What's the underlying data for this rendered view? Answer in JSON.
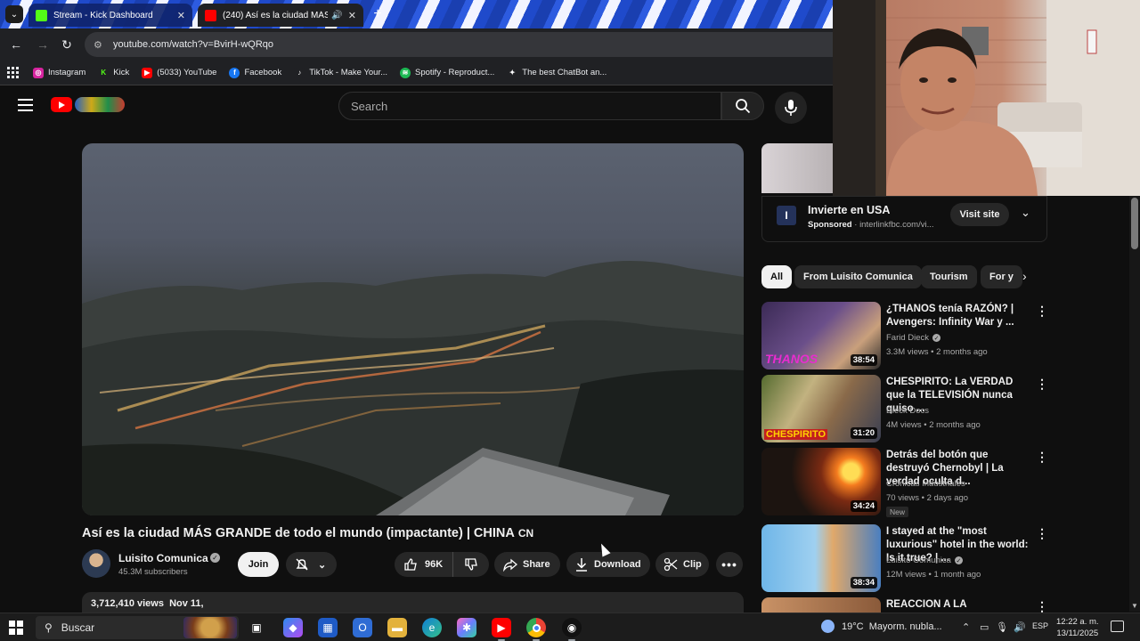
{
  "browser": {
    "tabs": [
      {
        "title": "Stream - Kick Dashboard",
        "favicon_color": "#53fc18",
        "active": false
      },
      {
        "title": "(240) Así es la ciudad MÁS",
        "favicon_color": "#ff0000",
        "active": true
      }
    ],
    "address": "youtube.com/watch?v=BvirH-wQRqo",
    "bookmarks": [
      {
        "label": "Instagram",
        "icon": "instagram-icon",
        "color": "#d6249f"
      },
      {
        "label": "Kick",
        "icon": "kick-icon",
        "color": "#53fc18"
      },
      {
        "label": "(5033) YouTube",
        "icon": "youtube-icon",
        "color": "#ff0000"
      },
      {
        "label": "Facebook",
        "icon": "facebook-icon",
        "color": "#1877f2"
      },
      {
        "label": "TikTok - Make Your...",
        "icon": "tiktok-icon",
        "color": "#111111"
      },
      {
        "label": "Spotify - Reproduct...",
        "icon": "spotify-icon",
        "color": "#1db954"
      },
      {
        "label": "The best ChatBot an...",
        "icon": "chatbot-icon",
        "color": "#444444"
      }
    ]
  },
  "youtube": {
    "search_placeholder": "Search",
    "video": {
      "title": "Así es la ciudad MÁS GRANDE de todo el mundo (impactante) | CHINA",
      "title_suffix": "CN",
      "channel": "Luisito Comunica",
      "subscribers": "45.3M subscribers",
      "join_label": "Join",
      "likes": "96K",
      "share_label": "Share",
      "download_label": "Download",
      "clip_label": "Clip",
      "views_date": "3,712,410 views  Nov 11,"
    },
    "ad": {
      "title": "Invierte en USA",
      "sponsored": "Sponsored",
      "domain": "· interlinkfbc.com/vi...",
      "visit_label": "Visit site"
    },
    "chips": [
      "All",
      "From Luisito Comunica",
      "Tourism",
      "For y"
    ],
    "recommendations": [
      {
        "title": "¿THANOS tenía RAZÓN? | Avengers: Infinity War y ...",
        "channel": "Farid Dieck",
        "verified": true,
        "meta": "3.3M views • 2 months ago",
        "duration": "38:54",
        "badge": "",
        "thumb_text": "THANOS"
      },
      {
        "title": "CHESPIRITO: La VERDAD que la TELEVISIÓN nunca quiso ...",
        "channel": "Dieck Docs",
        "verified": false,
        "meta": "4M views • 2 months ago",
        "duration": "31:20",
        "badge": "",
        "thumb_text": "CHESPIRITO"
      },
      {
        "title": "Detrás del botón que destruyó Chernobyl | La verdad oculta d...",
        "channel": "Crónicas Industriales",
        "verified": false,
        "meta": "70 views • 2 days ago",
        "duration": "34:24",
        "badge": "New",
        "thumb_text": ""
      },
      {
        "title": "I stayed at the \"most luxurious\" hotel in the world: Is it true? | ...",
        "channel": "Luisito Comunica",
        "verified": true,
        "meta": "12M views • 1 month ago",
        "duration": "38:34",
        "badge": "",
        "thumb_text": ""
      },
      {
        "title": "REACCION A LA ENTREVISTA",
        "channel": "",
        "verified": false,
        "meta": "",
        "duration": "",
        "badge": "",
        "thumb_text": ""
      }
    ]
  },
  "taskbar": {
    "search_placeholder": "Buscar",
    "weather": "19°C  Mayorm. nubla...",
    "language": "ESP",
    "time": "12:22 a. m.",
    "date": "13/11/2025"
  },
  "colors": {
    "youtube_red": "#ff0000",
    "background": "#0f0f0f",
    "surface": "#272727"
  }
}
